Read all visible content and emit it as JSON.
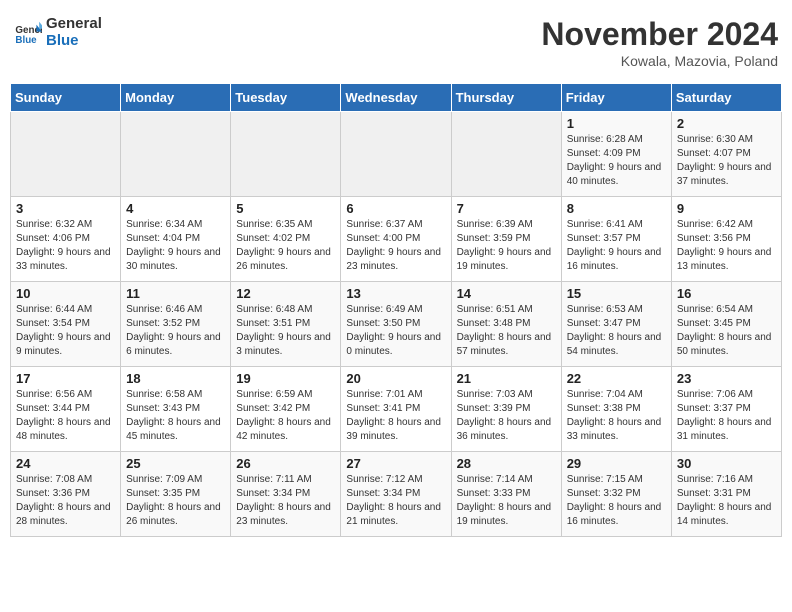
{
  "header": {
    "logo_line1": "General",
    "logo_line2": "Blue",
    "month_title": "November 2024",
    "location": "Kowala, Mazovia, Poland"
  },
  "weekdays": [
    "Sunday",
    "Monday",
    "Tuesday",
    "Wednesday",
    "Thursday",
    "Friday",
    "Saturday"
  ],
  "weeks": [
    [
      {
        "day": "",
        "info": ""
      },
      {
        "day": "",
        "info": ""
      },
      {
        "day": "",
        "info": ""
      },
      {
        "day": "",
        "info": ""
      },
      {
        "day": "",
        "info": ""
      },
      {
        "day": "1",
        "info": "Sunrise: 6:28 AM\nSunset: 4:09 PM\nDaylight: 9 hours and 40 minutes."
      },
      {
        "day": "2",
        "info": "Sunrise: 6:30 AM\nSunset: 4:07 PM\nDaylight: 9 hours and 37 minutes."
      }
    ],
    [
      {
        "day": "3",
        "info": "Sunrise: 6:32 AM\nSunset: 4:06 PM\nDaylight: 9 hours and 33 minutes."
      },
      {
        "day": "4",
        "info": "Sunrise: 6:34 AM\nSunset: 4:04 PM\nDaylight: 9 hours and 30 minutes."
      },
      {
        "day": "5",
        "info": "Sunrise: 6:35 AM\nSunset: 4:02 PM\nDaylight: 9 hours and 26 minutes."
      },
      {
        "day": "6",
        "info": "Sunrise: 6:37 AM\nSunset: 4:00 PM\nDaylight: 9 hours and 23 minutes."
      },
      {
        "day": "7",
        "info": "Sunrise: 6:39 AM\nSunset: 3:59 PM\nDaylight: 9 hours and 19 minutes."
      },
      {
        "day": "8",
        "info": "Sunrise: 6:41 AM\nSunset: 3:57 PM\nDaylight: 9 hours and 16 minutes."
      },
      {
        "day": "9",
        "info": "Sunrise: 6:42 AM\nSunset: 3:56 PM\nDaylight: 9 hours and 13 minutes."
      }
    ],
    [
      {
        "day": "10",
        "info": "Sunrise: 6:44 AM\nSunset: 3:54 PM\nDaylight: 9 hours and 9 minutes."
      },
      {
        "day": "11",
        "info": "Sunrise: 6:46 AM\nSunset: 3:52 PM\nDaylight: 9 hours and 6 minutes."
      },
      {
        "day": "12",
        "info": "Sunrise: 6:48 AM\nSunset: 3:51 PM\nDaylight: 9 hours and 3 minutes."
      },
      {
        "day": "13",
        "info": "Sunrise: 6:49 AM\nSunset: 3:50 PM\nDaylight: 9 hours and 0 minutes."
      },
      {
        "day": "14",
        "info": "Sunrise: 6:51 AM\nSunset: 3:48 PM\nDaylight: 8 hours and 57 minutes."
      },
      {
        "day": "15",
        "info": "Sunrise: 6:53 AM\nSunset: 3:47 PM\nDaylight: 8 hours and 54 minutes."
      },
      {
        "day": "16",
        "info": "Sunrise: 6:54 AM\nSunset: 3:45 PM\nDaylight: 8 hours and 50 minutes."
      }
    ],
    [
      {
        "day": "17",
        "info": "Sunrise: 6:56 AM\nSunset: 3:44 PM\nDaylight: 8 hours and 48 minutes."
      },
      {
        "day": "18",
        "info": "Sunrise: 6:58 AM\nSunset: 3:43 PM\nDaylight: 8 hours and 45 minutes."
      },
      {
        "day": "19",
        "info": "Sunrise: 6:59 AM\nSunset: 3:42 PM\nDaylight: 8 hours and 42 minutes."
      },
      {
        "day": "20",
        "info": "Sunrise: 7:01 AM\nSunset: 3:41 PM\nDaylight: 8 hours and 39 minutes."
      },
      {
        "day": "21",
        "info": "Sunrise: 7:03 AM\nSunset: 3:39 PM\nDaylight: 8 hours and 36 minutes."
      },
      {
        "day": "22",
        "info": "Sunrise: 7:04 AM\nSunset: 3:38 PM\nDaylight: 8 hours and 33 minutes."
      },
      {
        "day": "23",
        "info": "Sunrise: 7:06 AM\nSunset: 3:37 PM\nDaylight: 8 hours and 31 minutes."
      }
    ],
    [
      {
        "day": "24",
        "info": "Sunrise: 7:08 AM\nSunset: 3:36 PM\nDaylight: 8 hours and 28 minutes."
      },
      {
        "day": "25",
        "info": "Sunrise: 7:09 AM\nSunset: 3:35 PM\nDaylight: 8 hours and 26 minutes."
      },
      {
        "day": "26",
        "info": "Sunrise: 7:11 AM\nSunset: 3:34 PM\nDaylight: 8 hours and 23 minutes."
      },
      {
        "day": "27",
        "info": "Sunrise: 7:12 AM\nSunset: 3:34 PM\nDaylight: 8 hours and 21 minutes."
      },
      {
        "day": "28",
        "info": "Sunrise: 7:14 AM\nSunset: 3:33 PM\nDaylight: 8 hours and 19 minutes."
      },
      {
        "day": "29",
        "info": "Sunrise: 7:15 AM\nSunset: 3:32 PM\nDaylight: 8 hours and 16 minutes."
      },
      {
        "day": "30",
        "info": "Sunrise: 7:16 AM\nSunset: 3:31 PM\nDaylight: 8 hours and 14 minutes."
      }
    ]
  ]
}
